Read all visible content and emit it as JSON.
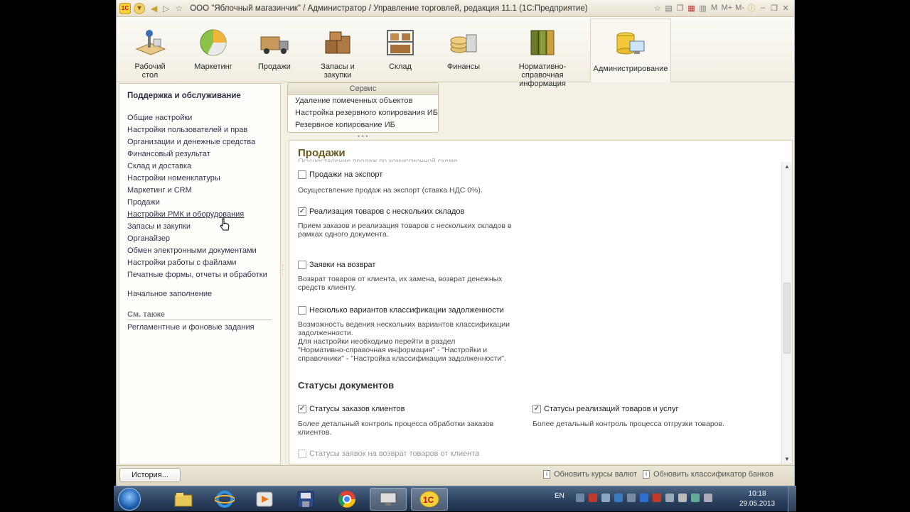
{
  "window": {
    "title": "ООО \"Яблочный магазинчик\" / Администратор / Управление торговлей, редакция 11.1  (1С:Предприятие)",
    "right_controls": [
      "M",
      "M+",
      "M-"
    ]
  },
  "sections": [
    {
      "label": "Рабочий\nстол",
      "icon": "desktop-icon"
    },
    {
      "label": "Маркетинг",
      "icon": "pie-chart-icon"
    },
    {
      "label": "Продажи",
      "icon": "truck-icon"
    },
    {
      "label": "Запасы и\nзакупки",
      "icon": "crates-icon"
    },
    {
      "label": "Склад",
      "icon": "warehouse-icon"
    },
    {
      "label": "Финансы",
      "icon": "coins-icon"
    },
    {
      "label": "Нормативно-справочная\nинформация",
      "icon": "binders-icon"
    },
    {
      "label": "Администрирование",
      "icon": "database-icon"
    }
  ],
  "left_panel": {
    "title": "Поддержка и обслуживание",
    "items": [
      "Общие настройки",
      "Настройки пользователей и прав",
      "Организации и денежные средства",
      "Финансовый результат",
      "Склад и доставка",
      "Настройки номенклатуры",
      "Маркетинг и CRM",
      "Продажи",
      "Настройки РМК и оборудования",
      "Запасы и закупки",
      "Органайзер",
      "Обмен электронными документами",
      "Настройки работы с файлами",
      "Печатные формы, отчеты и обработки"
    ],
    "start_fill": "Начальное заполнение",
    "see_also": "См. также",
    "regl": "Регламентные и фоновые задания"
  },
  "service": {
    "header": "Сервис",
    "items": [
      "Удаление помеченных объектов",
      "Настройка резервного копирования ИБ",
      "Резервное копирование ИБ"
    ]
  },
  "content": {
    "title": "Продажи",
    "cut_line": "Осуществление продаж по комиссионной схеме",
    "options": [
      {
        "label": "Продажи на экспорт",
        "checked": false,
        "desc": "Осуществление продаж на экспорт (ставка НДС 0%)."
      },
      {
        "label": "Реализация товаров с нескольких складов",
        "checked": true,
        "desc": "Прием заказов и реализация товаров с нескольких складов в\nрамках одного документа."
      },
      {
        "label": "Заявки на возврат",
        "checked": false,
        "desc": "Возврат товаров от клиента, их замена, возврат денежных\nсредств клиенту."
      },
      {
        "label": "Несколько вариантов классификации задолженности",
        "checked": false,
        "desc": "Возможность ведения нескольких вариантов классификации\nзадолженности.\nДля настройки необходимо перейти в раздел\n\"Нормативно-справочная информация\" - \"Настройки и\nсправочники\" - \"Настройка классификации задолженности\"."
      }
    ],
    "statuses_heading": "Статусы документов",
    "status_left": {
      "label": "Статусы заказов клиентов",
      "checked": true,
      "desc": "Более детальный контроль процесса обработки заказов\nклиентов."
    },
    "status_right": {
      "label": "Статусы реализаций товаров и услуг",
      "checked": true,
      "desc": "Более детальный контроль процесса отгрузки товаров."
    },
    "status_return": {
      "label": "Статусы заявок на возврат товаров от клиента",
      "checked": false,
      "disabled": true
    }
  },
  "statusbar": {
    "history": "История...",
    "link1": "Обновить курсы валют",
    "link2": "Обновить классификатор банков"
  },
  "taskbar": {
    "lang": "EN",
    "time": "10:18",
    "date": "29.05.2013"
  }
}
